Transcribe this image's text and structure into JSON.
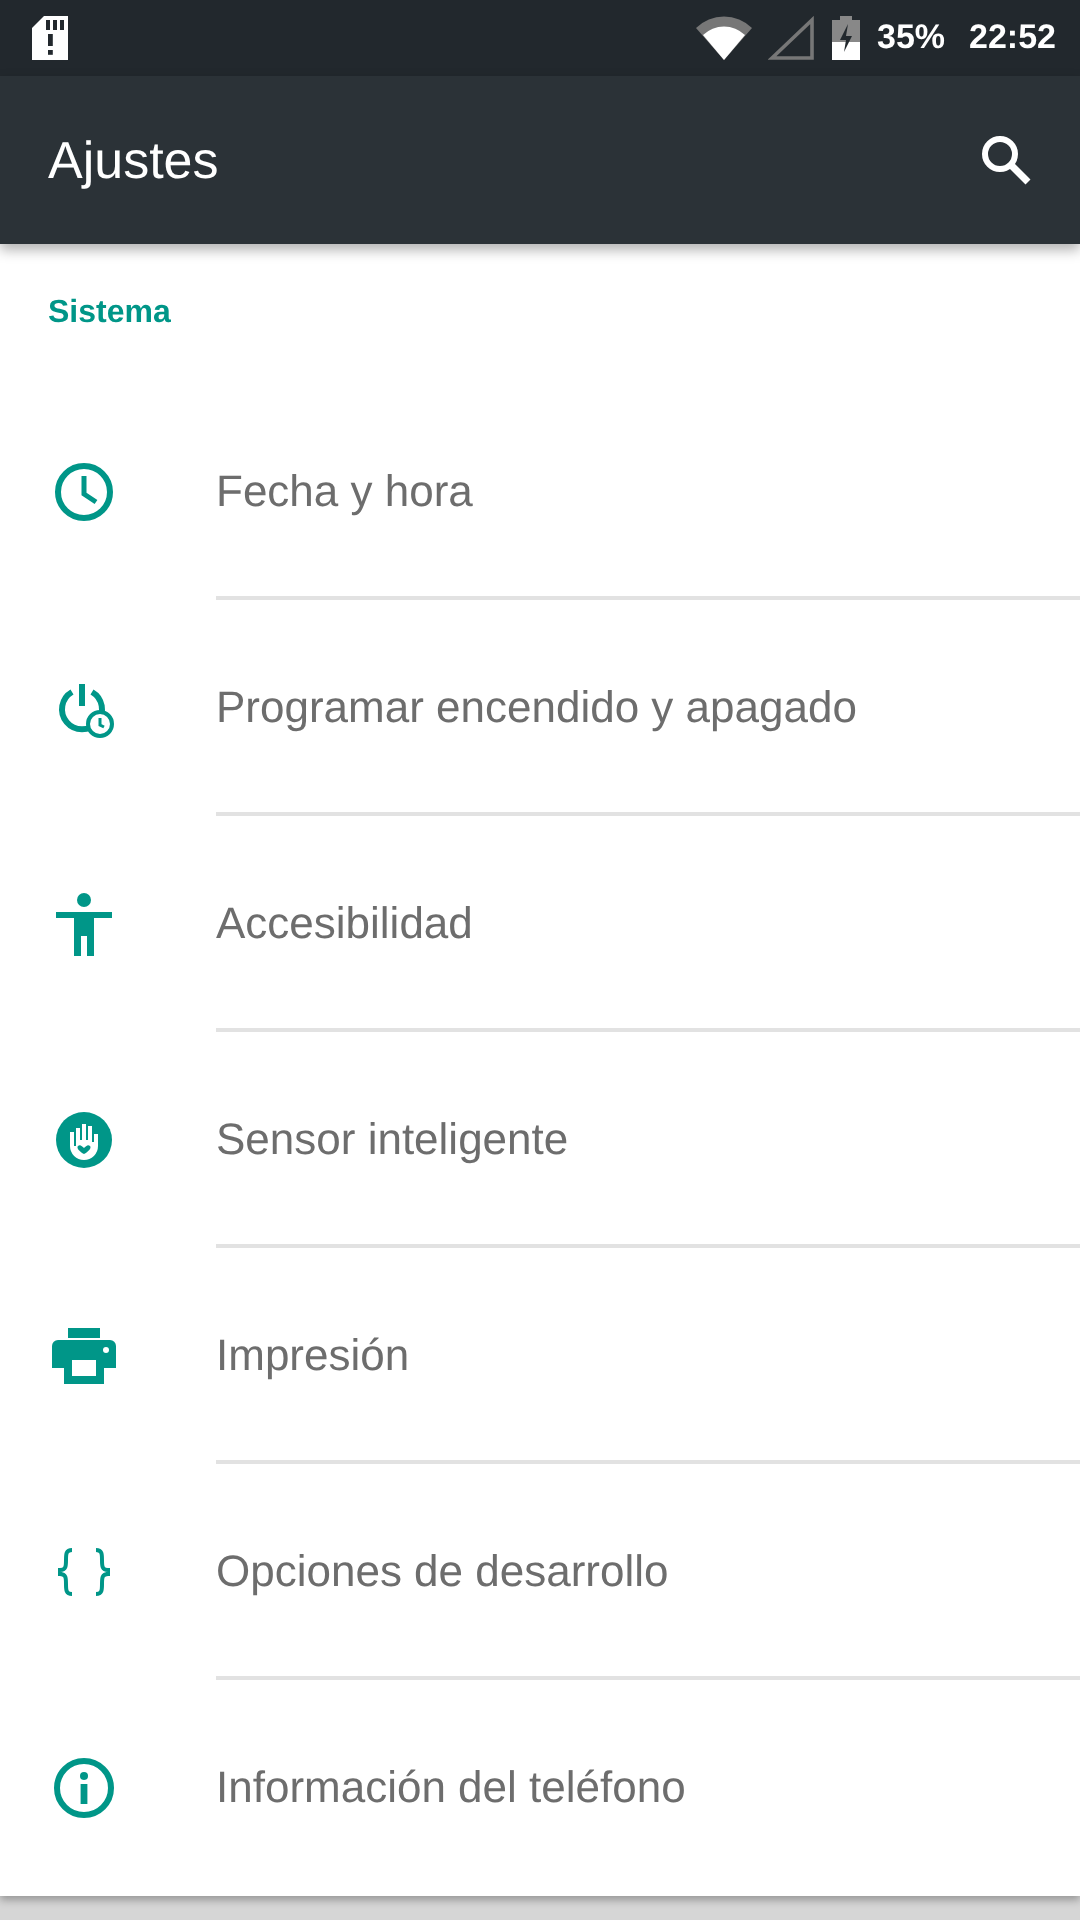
{
  "status_bar": {
    "battery": "35%",
    "time": "22:52"
  },
  "toolbar": {
    "title": "Ajustes"
  },
  "section": {
    "title": "Sistema"
  },
  "items": [
    {
      "label": "Fecha y hora"
    },
    {
      "label": "Programar encendido y apagado"
    },
    {
      "label": "Accesibilidad"
    },
    {
      "label": "Sensor inteligente"
    },
    {
      "label": "Impresión"
    },
    {
      "label": "Opciones de desarrollo"
    },
    {
      "label": "Información del teléfono"
    }
  ]
}
